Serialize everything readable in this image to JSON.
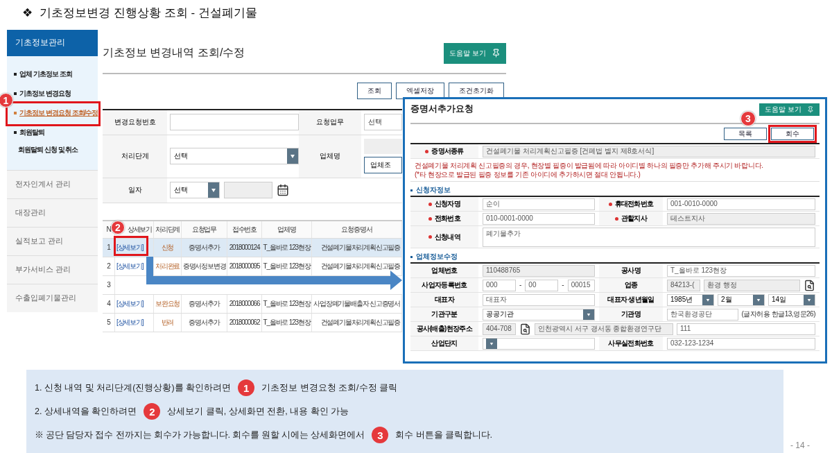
{
  "heading": {
    "bullet": "❖",
    "title": "기초정보변경 진행상황 조회 - 건설폐기물"
  },
  "sidebar": {
    "title": "기초정보관리",
    "items": [
      {
        "label": "업체 기초정보 조회",
        "selected": false
      },
      {
        "label": "기초정보 변경요청",
        "selected": false
      },
      {
        "label": "기초정보 변경요청 조회/수정",
        "selected": true
      },
      {
        "label": "회원탈퇴",
        "selected": false,
        "children": [
          {
            "label": "회원탈퇴 신청 및 취소",
            "selected": false
          }
        ]
      }
    ],
    "menus": [
      "전자인계서 관리",
      "대장관리",
      "실적보고 관리",
      "부가서비스 관리",
      "수출입폐기물관리"
    ]
  },
  "list_page": {
    "title": "기초정보 변경내역 조회/수정",
    "help_button": "도움말 보기",
    "buttons": [
      "조회",
      "엑셀저장",
      "조건초기화"
    ],
    "filters": [
      {
        "label": "변경요청번호",
        "kind": "input"
      },
      {
        "label": "요청업무",
        "kind": "input",
        "value": "선택"
      },
      {
        "label": "처리단계",
        "kind": "select",
        "value": "선택"
      },
      {
        "label": "업체명",
        "kind": "company",
        "button": "업체조"
      },
      {
        "label": "일자",
        "kind": "date",
        "value": "선택"
      }
    ],
    "columns": [
      "N",
      "상세보기",
      "처리단계",
      "요청업무",
      "접수번호",
      "업체명",
      "요청증명서"
    ],
    "rows": [
      {
        "selected": true,
        "cells": [
          "1",
          "[상세보기]",
          "신청",
          "증명서추가",
          "2018000124",
          "T_올바로 123현장",
          "건설폐기물처리계획신고필증"
        ]
      },
      {
        "selected": false,
        "cells": [
          "2",
          "[상세보기]",
          "처리완료",
          "증명서정보변경",
          "2018000095",
          "T_올바로 123현장",
          "건설폐기물처리계획신고필증"
        ]
      },
      {
        "selected": false,
        "cells": [
          "3"
        ]
      },
      {
        "selected": false,
        "cells": [
          "4",
          "[상세보기]",
          "보완요청",
          "증명서추가",
          "2018000066",
          "T_올바로 123현장",
          "사업장폐기물배출자 신고증명서"
        ]
      },
      {
        "selected": false,
        "cells": [
          "5",
          "[상세보기]",
          "반려",
          "증명서추가",
          "2018000062",
          "T_올바로 123현장",
          "건설폐기물처리계획신고필증"
        ]
      }
    ]
  },
  "detail": {
    "title": "증명서추가요청",
    "help_button": "도움말 보기",
    "buttons": [
      "목록",
      "회수"
    ],
    "certificate": {
      "label": "증명서종류",
      "value": "건설폐기물 처리계획신고필증 [건폐법 별지 제8호서식]"
    },
    "warnings": [
      "건설폐기물 처리계획 신고필증의 경우, 현장별 필증이 발급됨에 따라 아이디별 하나의 필증만 추가해 주시기 바랍니다.",
      "(*타 현장으로 발급된 필증 정보를 기존 아이디에 추가하시면 절대 안됩니다.)"
    ],
    "sections": [
      {
        "title": "신청자정보",
        "rows": [
          {
            "required": true,
            "label": "신청자명",
            "controls": [
              {
                "kind": "input",
                "value": "순이"
              }
            ],
            "label2": "휴대전화번호",
            "controls2": [
              {
                "kind": "input",
                "value": "001-0010-0000"
              }
            ]
          },
          {
            "required": true,
            "label": "전화번호",
            "controls": [
              {
                "kind": "input",
                "value": "010-0001-0000"
              }
            ],
            "label2": "관할지사",
            "controls2": [
              {
                "kind": "input",
                "value": "테스트지사",
                "disabled": true
              }
            ]
          },
          {
            "required": true,
            "label": "신청내역",
            "controls": [
              {
                "kind": "textarea",
                "value": "폐기물추가"
              }
            ]
          }
        ]
      },
      {
        "title": "업체정보수정",
        "rows": [
          {
            "required": false,
            "label": "업체번호",
            "controls": [
              {
                "kind": "input",
                "value": "110488765",
                "disabled": true
              }
            ],
            "label2": "공사명",
            "controls2": [
              {
                "kind": "input",
                "value": "T_올바로 123현장"
              }
            ]
          },
          {
            "required": false,
            "label": "사업자등록번호",
            "controls": [
              {
                "kind": "code",
                "value": "000"
              },
              {
                "kind": "sep",
                "value": "-"
              },
              {
                "kind": "code",
                "value": "00"
              },
              {
                "kind": "sep",
                "value": "-"
              },
              {
                "kind": "input",
                "value": "00015"
              }
            ],
            "label2": "업종",
            "controls2": [
              {
                "kind": "code",
                "value": "84213-(",
                "disabled": true
              },
              {
                "kind": "input",
                "value": "환경 행정",
                "disabled": true
              },
              {
                "kind": "search"
              }
            ]
          },
          {
            "required": false,
            "label": "대표자",
            "controls": [
              {
                "kind": "input",
                "value": "대표자"
              }
            ],
            "label2": "대표자 생년월일",
            "controls2": [
              {
                "kind": "select",
                "value": "1985년"
              },
              {
                "kind": "select",
                "value": "2월"
              },
              {
                "kind": "select",
                "value": "14일"
              }
            ]
          },
          {
            "required": false,
            "label": "기관구분",
            "controls": [
              {
                "kind": "select",
                "value": "공공기관"
              }
            ],
            "label2": "기관명",
            "controls2": [
              {
                "kind": "input",
                "value": "한국환경공단"
              },
              {
                "kind": "note",
                "value": "(글자허용 한글13,영문26)"
              }
            ]
          },
          {
            "required": false,
            "label": "공사(배출)현장주소",
            "controls": [
              {
                "kind": "code",
                "value": "404-708",
                "disabled": true
              },
              {
                "kind": "search"
              },
              {
                "kind": "input",
                "value": "인천광역시 서구 경서동 종합환경연구단",
                "disabled": true
              },
              {
                "kind": "input",
                "value": "111"
              }
            ]
          },
          {
            "required": false,
            "label": "산업단지",
            "controls": [
              {
                "kind": "select"
              }
            ],
            "label2": "사무실전화번호",
            "controls2": [
              {
                "kind": "input",
                "value": "032-123-1234"
              }
            ]
          }
        ]
      }
    ]
  },
  "markers": [
    "1",
    "2",
    "3"
  ],
  "guide": {
    "lines": [
      {
        "kind": "step",
        "before": "1. 신청 내역 및 처리단계(진행상황)를 확인하려면",
        "badge": "1",
        "after": "기초정보 변경요청 조회/수정 클릭"
      },
      {
        "kind": "step",
        "before": "2. 상세내역을 확인하려면",
        "badge": "2",
        "after": "상세보기 클릭, 상세화면 전환, 내용 확인 가능"
      },
      {
        "kind": "note",
        "before": "※ 공단 담당자 접수 전까지는 회수가 가능합니다. 회수를 원할 시에는 상세화면에서",
        "badge": "3",
        "after": "회수 버튼을 클릭합니다."
      }
    ]
  },
  "page_number": "- 14 -"
}
